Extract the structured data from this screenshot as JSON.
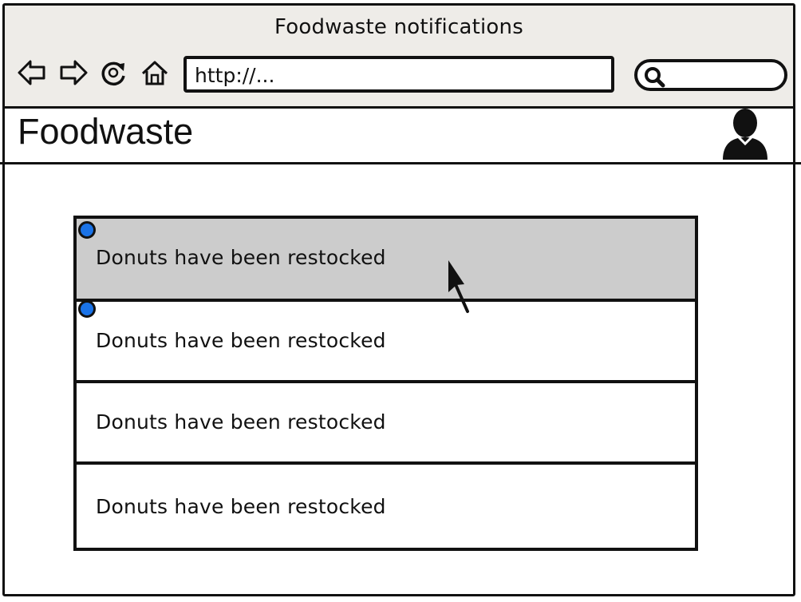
{
  "browser": {
    "window_title": "Foodwaste notifications",
    "url": "http://...",
    "search_placeholder": ""
  },
  "app": {
    "name": "Foodwaste"
  },
  "notifications": [
    {
      "text": "Donuts have been restocked",
      "unread": true,
      "hovered": true
    },
    {
      "text": "Donuts have been restocked",
      "unread": true,
      "hovered": false
    },
    {
      "text": "Donuts have been restocked",
      "unread": false,
      "hovered": false
    },
    {
      "text": "Donuts have been restocked",
      "unread": false,
      "hovered": false
    }
  ],
  "colors": {
    "unread_dot": "#1a73e8",
    "hover_row": "#cccccc",
    "chrome": "#eeece8"
  },
  "icons": {
    "back": "back-arrow-icon",
    "forward": "forward-arrow-icon",
    "reload": "reload-icon",
    "home": "home-icon",
    "search": "search-icon",
    "user": "user-avatar-icon",
    "cursor": "mouse-cursor-icon"
  }
}
